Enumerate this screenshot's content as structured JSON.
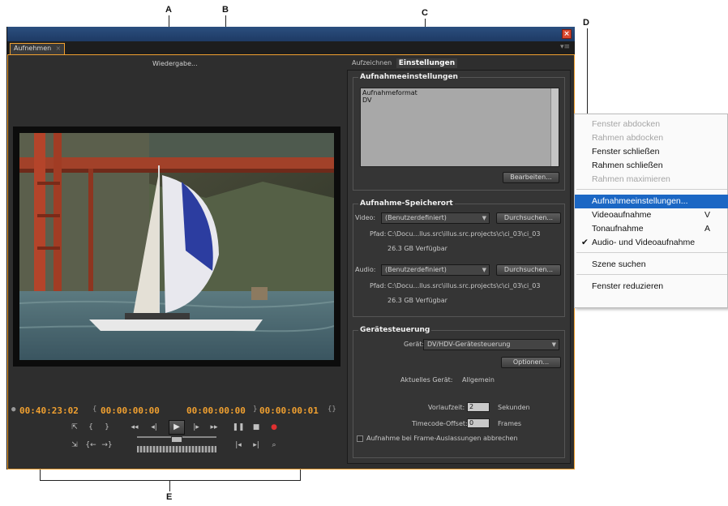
{
  "callouts": {
    "a": "A",
    "b": "B",
    "c": "C",
    "d": "D",
    "e": "E"
  },
  "window": {
    "close_glyph": "×",
    "panel_tab": "Aufnehmen",
    "panel_tab_close": "×",
    "panel_menu": "▾≡"
  },
  "monitor": {
    "playback_label": "Wiedergabe...",
    "timecodes": {
      "current": "00:40:23:02",
      "in_point": "00:00:00:00",
      "out_point": "00:00:00:00",
      "duration": "00:00:00:01"
    }
  },
  "tabs": [
    {
      "label": "Aufzeichnen",
      "active": false
    },
    {
      "label": "Einstellungen",
      "active": true
    }
  ],
  "capture_settings": {
    "title": "Aufnahmeeinstellungen",
    "format_label": "Aufnahmeformat",
    "format_value": "DV",
    "edit_button": "Bearbeiten..."
  },
  "storage": {
    "title": "Aufnahme-Speicherort",
    "video_label": "Video:",
    "video_select": "(Benutzerdefiniert)",
    "video_browse": "Durchsuchen...",
    "video_path_label": "Pfad:",
    "video_path": "C:\\Docu...llus.src\\illus.src.projects\\c\\ci_03\\ci_03",
    "video_free": "26.3 GB Verfügbar",
    "audio_label": "Audio:",
    "audio_select": "(Benutzerdefiniert)",
    "audio_browse": "Durchsuchen...",
    "audio_path_label": "Pfad:",
    "audio_path": "C:\\Docu...llus.src\\illus.src.projects\\c\\ci_03\\ci_03",
    "audio_free": "26.3 GB Verfügbar"
  },
  "device": {
    "title": "Gerätesteuerung",
    "device_label": "Gerät:",
    "device_select": "DV/HDV-Gerätesteuerung",
    "options_button": "Optionen...",
    "current_device_label": "Aktuelles Gerät:",
    "current_device": "Allgemein",
    "preroll_label": "Vorlaufzeit:",
    "preroll_value": "2",
    "preroll_unit": "Sekunden",
    "offset_label": "Timecode-Offset:",
    "offset_value": "0",
    "offset_unit": "Frames",
    "abort_label": "Aufnahme bei Frame-Auslassungen abbrechen"
  },
  "context_menu": [
    {
      "label": "Fenster abdocken",
      "disabled": true
    },
    {
      "label": "Rahmen abdocken",
      "disabled": true
    },
    {
      "label": "Fenster schließen",
      "disabled": false
    },
    {
      "label": "Rahmen schließen",
      "disabled": false
    },
    {
      "label": "Rahmen maximieren",
      "disabled": true
    },
    {
      "label": "Aufnahmeeinstellungen...",
      "highlight": true
    },
    {
      "label": "Videoaufnahme",
      "shortcut": "V"
    },
    {
      "label": "Tonaufnahme",
      "shortcut": "A"
    },
    {
      "label": "Audio- und Videoaufnahme",
      "checked": true,
      "check": "✔"
    },
    {
      "label": "Szene suchen"
    },
    {
      "label": "Fenster reduzieren"
    }
  ]
}
